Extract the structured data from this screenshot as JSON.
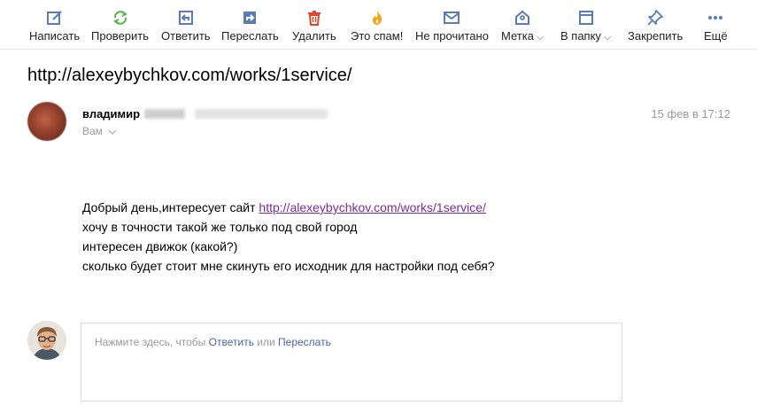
{
  "toolbar": {
    "compose": "Написать",
    "check": "Проверить",
    "reply": "Ответить",
    "forward": "Переслать",
    "delete": "Удалить",
    "spam": "Это спам!",
    "unread": "Не прочитано",
    "label": "Метка",
    "folder": "В папку",
    "pin": "Закрепить",
    "more": "Ещё",
    "caret": "⌵"
  },
  "icons": {
    "compose": "pencil-square-icon",
    "check": "refresh-icon",
    "reply": "reply-arrow-icon",
    "forward": "forward-arrow-icon",
    "delete": "trash-icon",
    "spam": "flame-icon",
    "unread": "envelope-icon",
    "label": "tag-icon",
    "folder": "folder-icon",
    "pin": "pin-icon",
    "more": "dots-icon"
  },
  "colors": {
    "icon_blue": "#5b7bb6",
    "icon_green": "#58b04a",
    "icon_red": "#e0462f",
    "icon_orange": "#f3a61b",
    "link_purple": "#7d2b9b",
    "link_blue": "#4a64a8"
  },
  "message": {
    "subject": "http://alexeybychkov.com/works/1service/",
    "sender_name": "владимир",
    "to": "Вам",
    "date": "15 фев в 17:12",
    "greeting": "Добрый день,интересует сайт ",
    "link": "http://alexeybychkov.com/works/1service/",
    "line2": "хочу в точности такой же только под свой город",
    "line3": "интересен движок (какой?)",
    "line4": "сколько будет стоит мне скинуть его исходник для настройки под себя?"
  },
  "reply_box": {
    "prefix": "Нажмите здесь, чтобы ",
    "reply_link": "Ответить",
    "or": " или ",
    "forward_link": "Переслать"
  }
}
